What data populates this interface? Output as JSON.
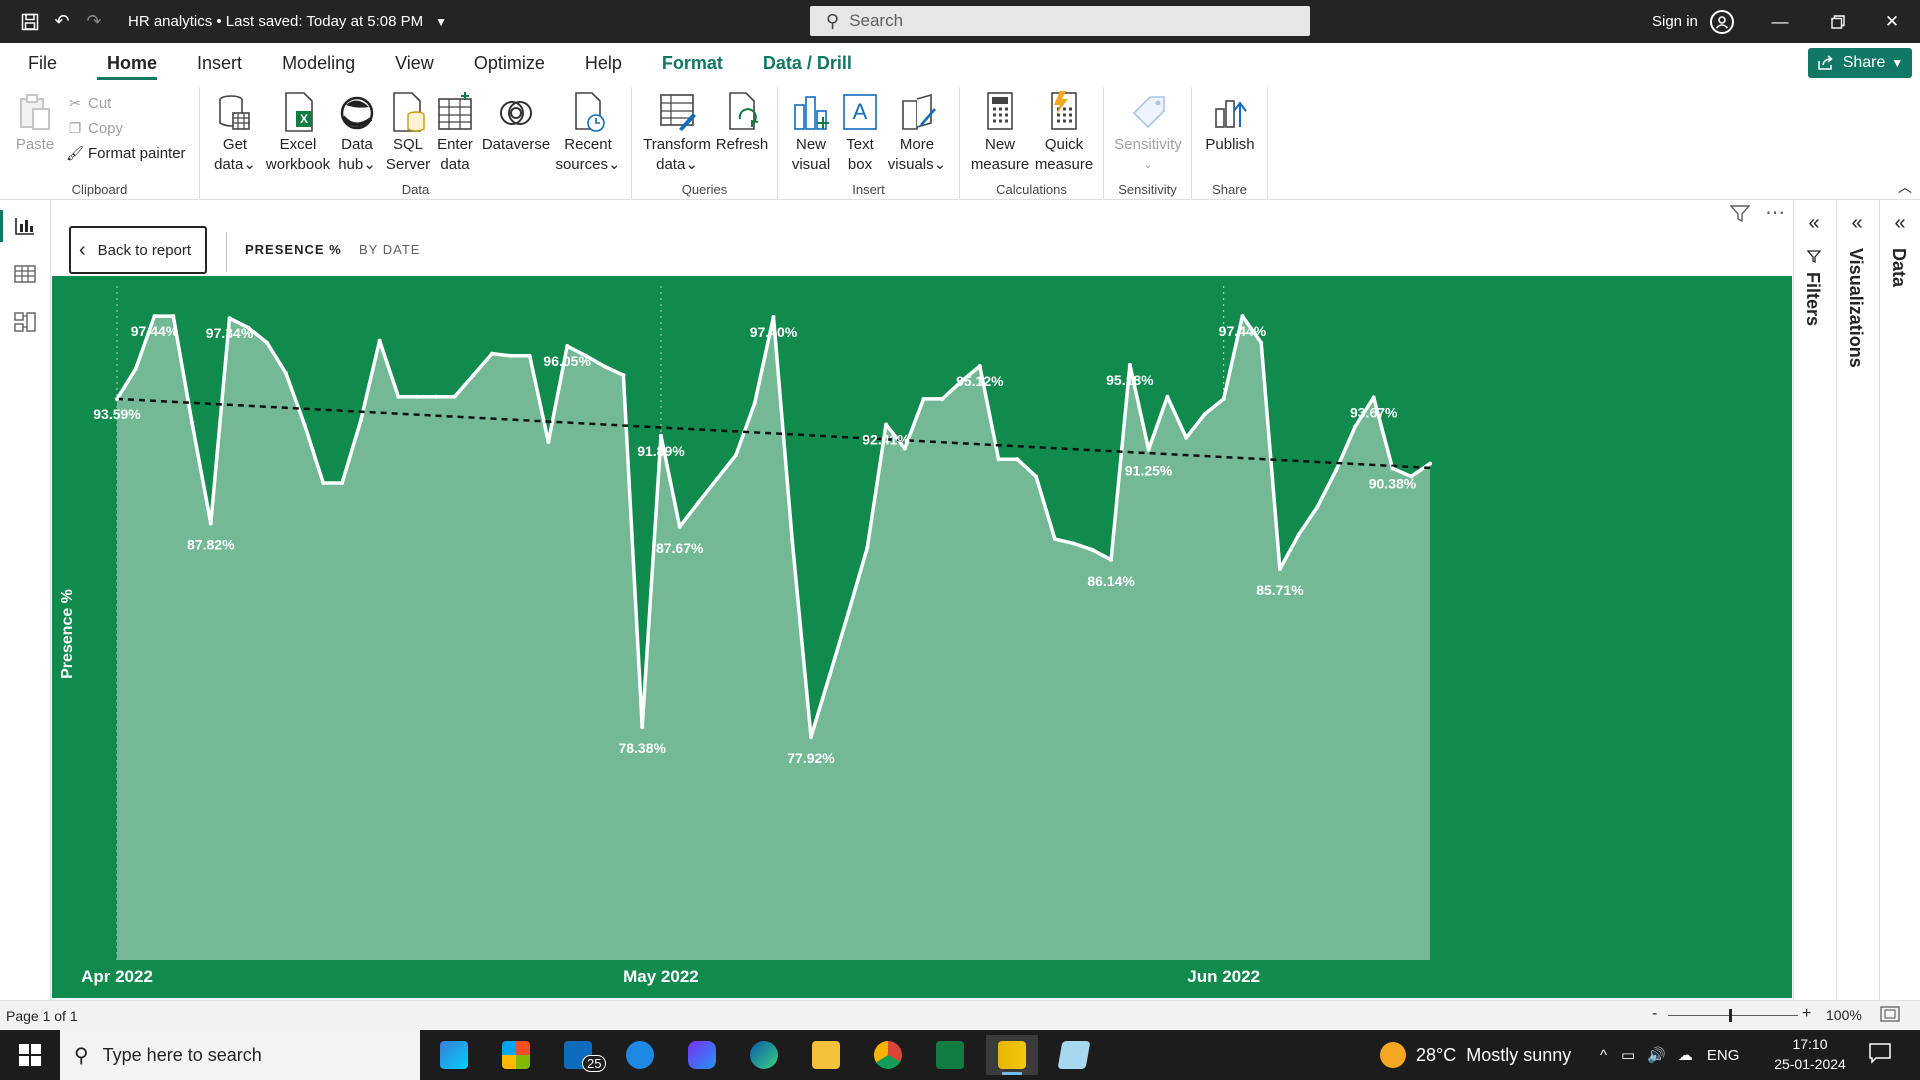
{
  "titlebar": {
    "document_title": "HR analytics",
    "saved_status": "Last saved: Today at 5:08 PM",
    "search_placeholder": "Search",
    "sign_in": "Sign in"
  },
  "menu": {
    "tabs": [
      {
        "label": "File"
      },
      {
        "label": "Home",
        "active": true
      },
      {
        "label": "Insert"
      },
      {
        "label": "Modeling"
      },
      {
        "label": "View"
      },
      {
        "label": "Optimize"
      },
      {
        "label": "Help"
      },
      {
        "label": "Format"
      },
      {
        "label": "Data / Drill"
      }
    ],
    "share_label": "Share"
  },
  "ribbon": {
    "clipboard": {
      "paste": "Paste",
      "cut": "Cut",
      "copy": "Copy",
      "format_painter": "Format painter",
      "group_label": "Clipboard"
    },
    "data": {
      "get_data": [
        "Get",
        "data"
      ],
      "excel": [
        "Excel",
        "workbook"
      ],
      "data_hub": [
        "Data",
        "hub"
      ],
      "sql": [
        "SQL",
        "Server"
      ],
      "enter_data": [
        "Enter",
        "data"
      ],
      "dataverse": [
        "Dataverse"
      ],
      "recent": [
        "Recent",
        "sources"
      ],
      "group_label": "Data"
    },
    "queries": {
      "transform": [
        "Transform",
        "data"
      ],
      "refresh": [
        "Refresh"
      ],
      "group_label": "Queries"
    },
    "insert": {
      "new_visual": [
        "New",
        "visual"
      ],
      "text_box": [
        "Text",
        "box"
      ],
      "more_visuals": [
        "More",
        "visuals"
      ],
      "group_label": "Insert"
    },
    "calculations": {
      "new_measure": [
        "New",
        "measure"
      ],
      "quick_measure": [
        "Quick",
        "measure"
      ],
      "group_label": "Calculations"
    },
    "sensitivity": {
      "sensitivity": [
        "Sensitivity"
      ],
      "group_label": "Sensitivity"
    },
    "share": {
      "publish": [
        "Publish"
      ],
      "group_label": "Share"
    }
  },
  "focus": {
    "back_label": "Back to report",
    "title_measure": "PRESENCE %",
    "title_by": "BY DATE"
  },
  "panes": {
    "filters": "Filters",
    "visualizations": "Visualizations",
    "data": "Data"
  },
  "chart_data": {
    "type": "area",
    "ylabel": "Presence %",
    "xlabel": "",
    "x_tick_labels": [
      "Apr 2022",
      "May 2022",
      "Jun 2022"
    ],
    "ylim": [
      75,
      98
    ],
    "trendline": true,
    "colors": {
      "background": "#118a4e",
      "area": "#73b995",
      "line": "#ffffff",
      "trend": "#111111"
    },
    "series": [
      {
        "values": [
          93.59,
          95.0,
          97.44,
          97.44,
          92.5,
          87.82,
          97.34,
          96.9,
          96.2,
          94.8,
          92.4,
          89.7,
          89.7,
          92.6,
          96.3,
          93.7,
          93.7,
          93.7,
          93.7,
          94.7,
          95.7,
          95.6,
          95.6,
          91.6,
          96.05,
          95.6,
          95.1,
          94.7,
          78.38,
          91.89,
          87.67,
          88.8,
          89.9,
          91.0,
          93.4,
          97.4,
          87.0,
          77.92,
          80.8,
          83.7,
          86.7,
          92.41,
          91.3,
          93.6,
          93.6,
          94.4,
          95.12,
          90.8,
          90.8,
          90.0,
          87.1,
          86.9,
          86.6,
          86.14,
          95.18,
          91.25,
          93.7,
          91.8,
          92.9,
          93.6,
          97.44,
          96.2,
          85.71,
          87.3,
          88.6,
          90.3,
          92.3,
          93.67,
          90.38,
          90.0,
          90.6
        ],
        "labels": [
          {
            "index": 0,
            "text": "93.59%"
          },
          {
            "index": 2,
            "text": "97.44%"
          },
          {
            "index": 5,
            "text": "87.82%"
          },
          {
            "index": 6,
            "text": "97.34%"
          },
          {
            "index": 24,
            "text": "96.05%"
          },
          {
            "index": 28,
            "text": "78.38%"
          },
          {
            "index": 29,
            "text": "91.89%"
          },
          {
            "index": 30,
            "text": "87.67%"
          },
          {
            "index": 35,
            "text": "97.40%"
          },
          {
            "index": 37,
            "text": "77.92%"
          },
          {
            "index": 41,
            "text": "92.41%"
          },
          {
            "index": 46,
            "text": "95.12%"
          },
          {
            "index": 53,
            "text": "86.14%"
          },
          {
            "index": 54,
            "text": "95.18%"
          },
          {
            "index": 55,
            "text": "91.25%"
          },
          {
            "index": 60,
            "text": "97.44%"
          },
          {
            "index": 62,
            "text": "85.71%"
          },
          {
            "index": 67,
            "text": "93.67%"
          },
          {
            "index": 68,
            "text": "90.38%"
          }
        ]
      }
    ],
    "trend": {
      "start": 93.6,
      "end": 90.4
    }
  },
  "status": {
    "page": "Page 1 of 1",
    "zoom": "100%"
  },
  "taskbar": {
    "search_placeholder": "Type here to search",
    "mail_badge": "25",
    "weather": "28°C  Mostly sunny",
    "lang": "ENG",
    "time": "17:10",
    "date": "25-01-2024"
  }
}
